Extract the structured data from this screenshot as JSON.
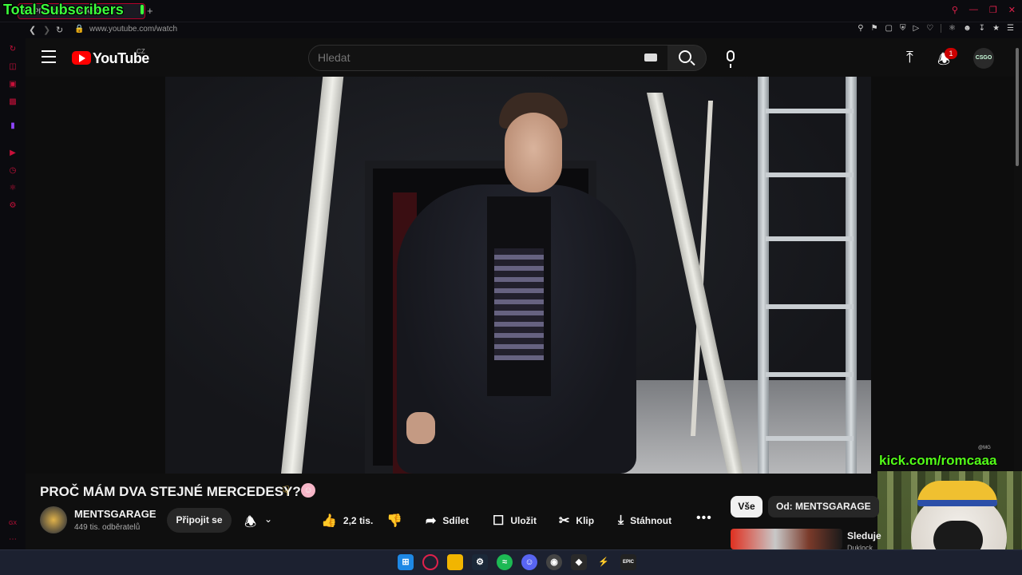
{
  "browser": {
    "overlay_text": "Total Subscribers",
    "tab_title": "(1) PROČ MÁM DVA ST",
    "new_tab_symbol": "+",
    "url": "www.youtube.com/watch",
    "sidebar_label_bottom": "GX"
  },
  "youtube": {
    "logo_text": "YouTube",
    "country_code": "CZ",
    "search_placeholder": "Hledat",
    "notifications_count": "1",
    "account_avatar_text": "CSGO"
  },
  "stream_overlay": {
    "kick_url": "kick.com/romcaaa",
    "video_watermark": "@MG"
  },
  "video": {
    "title": "PROČ MÁM DVA STEJNÉ MERCEDESY?",
    "channel_name": "MENTSGARAGE",
    "subscribers": "449 tis. odběratelů",
    "join_label": "Připojit se",
    "likes": "2,2 tis.",
    "share_label": "Sdílet",
    "save_label": "Uložit",
    "clip_label": "Klip",
    "download_label": "Stáhnout"
  },
  "recommendations": {
    "chips": [
      "Vše",
      "Od: MENTSGARAGE"
    ],
    "first_title": "Sleduje",
    "first_subtitle": "Duklock"
  },
  "taskbar": {
    "epic_label": "EPIC"
  },
  "colors": {
    "accent_red": "#ff0000",
    "opera_red": "#c8103a",
    "kick_green": "#53fc18",
    "overlay_green": "#3cff3c"
  }
}
